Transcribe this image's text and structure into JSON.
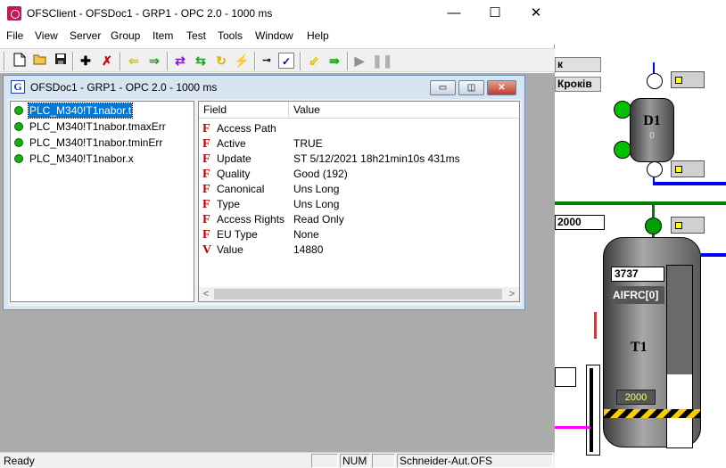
{
  "app": {
    "title": "OFSClient - OFSDoc1 - GRP1 - OPC 2.0 - 1000 ms",
    "min_glyph": "—",
    "max_glyph": "☐",
    "close_glyph": "✕"
  },
  "menu": [
    "File",
    "View",
    "Server",
    "Group",
    "Item",
    "Test",
    "Tools",
    "Window",
    "Help"
  ],
  "toolbar": {
    "icons": [
      "new-doc-icon",
      "open-folder-icon",
      "save-icon",
      "add-item-icon",
      "delete-item-icon",
      "arrow-left-icon",
      "arrow-right-icon",
      "swap-icon",
      "swap-alt-icon",
      "refresh-icon",
      "disconnect-icon",
      "connect-icon",
      "validate-icon",
      "read-icon",
      "write-icon",
      "play-icon",
      "pause-icon"
    ]
  },
  "child": {
    "icon_letter": "G",
    "title": "OFSDoc1 - GRP1 - OPC 2.0 - 1000 ms",
    "min_glyph": "▭",
    "max_glyph": "◫",
    "close_glyph": "✕"
  },
  "items": [
    {
      "label": "PLC_M340!T1nabor.t",
      "selected": true,
      "status_color": "#12b012"
    },
    {
      "label": "PLC_M340!T1nabor.tmaxErr",
      "selected": false,
      "status_color": "#12b012"
    },
    {
      "label": "PLC_M340!T1nabor.tminErr",
      "selected": false,
      "status_color": "#12b012"
    },
    {
      "label": "PLC_M340!T1nabor.x",
      "selected": false,
      "status_color": "#12b012"
    }
  ],
  "props": {
    "col_field": "Field",
    "col_value": "Value",
    "rows": [
      {
        "flag": "F",
        "field": "Access Path",
        "value": ""
      },
      {
        "flag": "F",
        "field": "Active",
        "value": "TRUE"
      },
      {
        "flag": "F",
        "field": "Update",
        "value": "ST 5/12/2021 18h21min10s 431ms"
      },
      {
        "flag": "F",
        "field": "Quality",
        "value": "Good (192)"
      },
      {
        "flag": "F",
        "field": "Canonical",
        "value": "Uns Long"
      },
      {
        "flag": "F",
        "field": "Type",
        "value": "Uns Long"
      },
      {
        "flag": "F",
        "field": "Access Rights",
        "value": "Read Only"
      },
      {
        "flag": "F",
        "field": "EU Type",
        "value": "None"
      },
      {
        "flag": "V",
        "field": "Value",
        "value": "14880"
      }
    ],
    "scroll_left": "<",
    "scroll_right": ">"
  },
  "status": {
    "ready": "Ready",
    "num": "NUM",
    "server": "Schneider-Aut.OFS"
  },
  "scada": {
    "box1": "к",
    "box2": "Кроків",
    "tank_d1": "D1",
    "tank_d1_value": "0",
    "setpoint_top": "2000",
    "tank_t1_value": "3737",
    "tank_t1_tag": "AIFRC[0]",
    "tank_t1": "T1",
    "tank_t1_setpoint": "2000",
    "colors": {
      "pipe_blue": "#0000ff",
      "pipe_green": "#008000",
      "valve_green": "#00c000",
      "tank_grey": "#6e6e6e"
    }
  }
}
